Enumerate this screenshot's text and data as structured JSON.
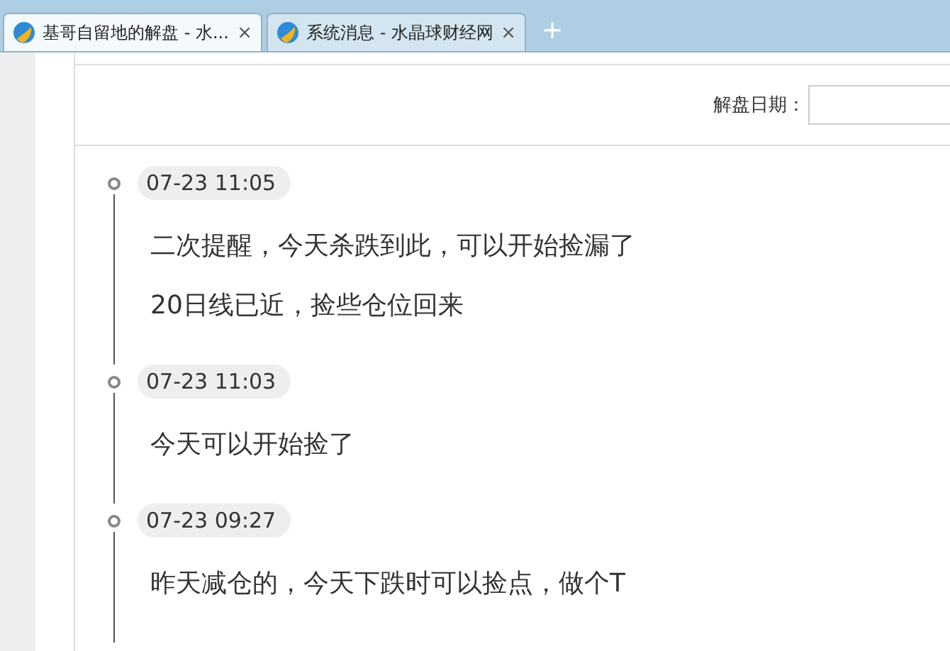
{
  "tabs": [
    {
      "title": "基哥自留地的解盘 - 水...",
      "close": "×",
      "selected": true
    },
    {
      "title": "系统消息 - 水晶球财经网",
      "close": "×",
      "selected": false
    }
  ],
  "new_tab": "+",
  "filter": {
    "label": "解盘日期："
  },
  "timeline": [
    {
      "time": "07-23 11:05",
      "lines": [
        "二次提醒，今天杀跌到此，可以开始捡漏了",
        "20日线已近，捡些仓位回来"
      ]
    },
    {
      "time": "07-23 11:03",
      "lines": [
        "今天可以开始捡了"
      ]
    },
    {
      "time": "07-23 09:27",
      "lines": [
        "昨天减仓的，今天下跌时可以捡点，做个T"
      ]
    }
  ]
}
